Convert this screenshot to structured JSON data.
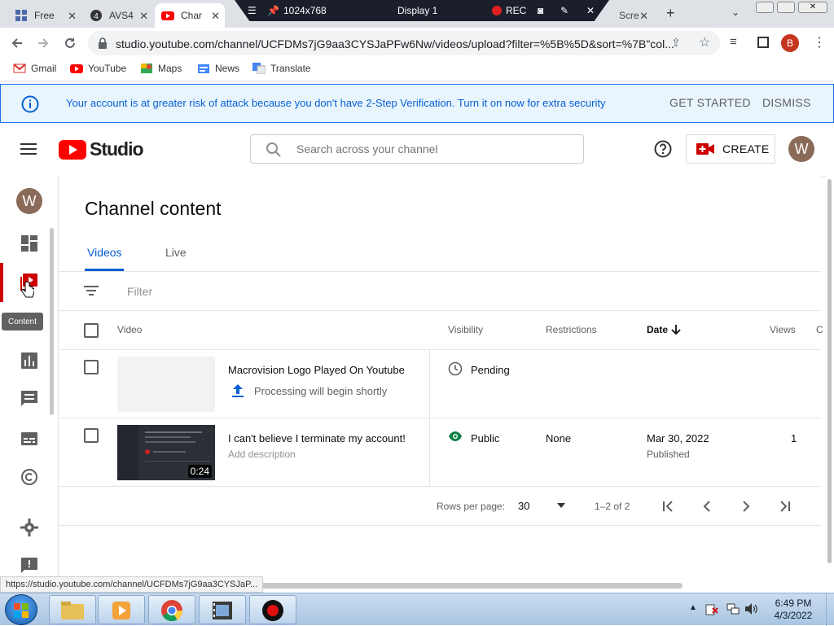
{
  "browser": {
    "tabs": [
      {
        "label": "Free"
      },
      {
        "label": "AVS4"
      },
      {
        "label": "Char"
      },
      {
        "label": "Scre"
      }
    ],
    "recorder": {
      "size": "1024x768",
      "display": "Display 1",
      "rec": "REC"
    },
    "url": "studio.youtube.com/channel/UCFDMs7jG9aa3CYSJaPFw6Nw/videos/upload?filter=%5B%5D&sort=%7B\"col...",
    "profile_initial": "B",
    "bookmarks": [
      "Gmail",
      "YouTube",
      "Maps",
      "News",
      "Translate"
    ]
  },
  "banner": {
    "text": "Your account is at greater risk of attack because you don't have 2-Step Verification. Turn it on now for extra security",
    "get_started": "GET STARTED",
    "dismiss": "DISMISS"
  },
  "header": {
    "logo_text": "Studio",
    "search_placeholder": "Search across your channel",
    "create_label": "CREATE",
    "avatar_initial": "W"
  },
  "sidebar": {
    "avatar_initial": "W",
    "tooltip": "Content"
  },
  "main": {
    "title": "Channel content",
    "tabs": [
      {
        "label": "Videos",
        "active": true
      },
      {
        "label": "Live",
        "active": false
      }
    ],
    "filter_placeholder": "Filter",
    "columns": {
      "video": "Video",
      "visibility": "Visibility",
      "restrictions": "Restrictions",
      "date": "Date",
      "views": "Views",
      "comments": "C"
    },
    "rows": [
      {
        "title": "Macrovision Logo Played On Youtube",
        "subtitle": "Processing will begin shortly",
        "visibility": "Pending",
        "restrictions": "",
        "date": "",
        "date_status": "",
        "views": ""
      },
      {
        "title": "I can't believe I terminate my account!",
        "subtitle": "Add description",
        "duration": "0:24",
        "visibility": "Public",
        "restrictions": "None",
        "date": "Mar 30, 2022",
        "date_status": "Published",
        "views": "1"
      }
    ],
    "pagination": {
      "rows_per_page_label": "Rows per page:",
      "rows_per_page": "30",
      "range": "1–2 of 2"
    }
  },
  "status_url": "https://studio.youtube.com/channel/UCFDMs7jG9aa3CYSJaP...",
  "taskbar": {
    "time": "6:49 PM",
    "date": "4/3/2022"
  },
  "colors": {
    "brand_red": "#ff0000",
    "link_blue": "#065fd4",
    "public_green": "#0b8043"
  }
}
